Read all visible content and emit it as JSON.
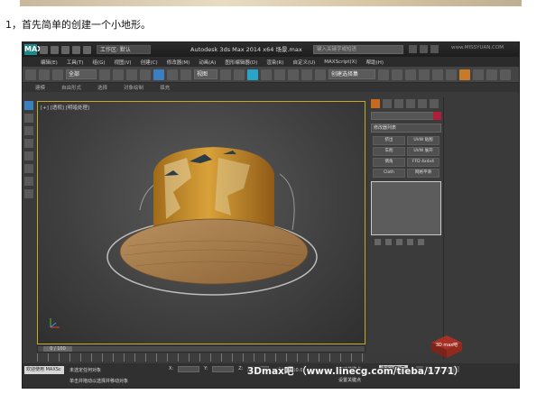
{
  "caption": "1，首先简单的创建一个小地形。",
  "titlebar": {
    "logo": "MAX",
    "workspace": "工作区: 默认",
    "title": "Autodesk 3ds Max  2014 x64      场景.max",
    "search_placeholder": "键入关键字或短语",
    "site": "www.MISSYUAN.COM"
  },
  "menu": [
    "编辑(E)",
    "工具(T)",
    "组(G)",
    "视图(V)",
    "创建(C)",
    "修改器(M)",
    "动画(A)",
    "图形编辑器(D)",
    "渲染(R)",
    "自定义(U)",
    "MAXScript(X)",
    "帮助(H)"
  ],
  "toolbar": {
    "filter": "全部",
    "view": "视图",
    "selection_set": "创建选择集"
  },
  "ribbon": [
    "建模",
    "自由形式",
    "选择",
    "对象绘制",
    "填充"
  ],
  "viewport": {
    "label": "[+] [透视] [明暗处理]"
  },
  "command_panel": {
    "modifier_list": "修改器列表",
    "buttons": [
      "挤出",
      "UVW 贴图",
      "车削",
      "UVW 展开",
      "倒角",
      "FFD 4x4x4",
      "Cloth",
      "网格平滑"
    ]
  },
  "timeline": {
    "frame": "0 / 100"
  },
  "status": {
    "welcome": "欢迎使用 MAXSc",
    "line1": "未选定任何对象",
    "line2": "单击并拖动以选择并移动对象",
    "x_label": "X:",
    "y_label": "Y:",
    "z_label": "Z:",
    "grid": "栅格 = 10.0",
    "autokey": "自动关键点",
    "selected": "选定对象",
    "filter": "设置关键点"
  },
  "watermark": {
    "logo_text": "3D max吧",
    "bottom": "3Dmax吧 （www.linecg.com/tieba/1771）"
  },
  "colors": {
    "viewport_border": "#c6a827",
    "swatch": "#b01e3a",
    "active_tab": "#c56a1f"
  }
}
